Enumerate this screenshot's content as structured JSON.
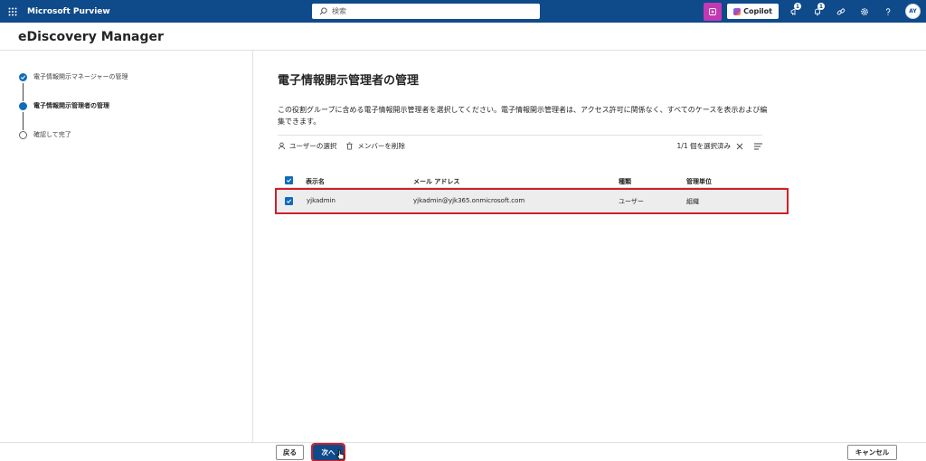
{
  "topbar": {
    "app_name": "Microsoft Purview",
    "search_placeholder": "検索",
    "copilot_label": "Copilot",
    "notification_badge_1": "1",
    "notification_badge_2": "1",
    "avatar_initials": "AY"
  },
  "header": {
    "title": "eDiscovery Manager"
  },
  "steps": [
    {
      "label": "電子情報開示マネージャーの管理",
      "state": "done"
    },
    {
      "label": "電子情報開示管理者の管理",
      "state": "current"
    },
    {
      "label": "確認して完了",
      "state": "todo"
    }
  ],
  "main": {
    "title": "電子情報開示管理者の管理",
    "description": "この役割グループに含める電子情報開示管理者を選択してください。電子情報開示管理者は、アクセス許可に関係なく、すべてのケースを表示および編集できます。",
    "commands": {
      "select_users": "ユーザーの選択",
      "remove_members": "メンバーを削除",
      "selection_status": "1/1 個を選択済み"
    },
    "table": {
      "columns": [
        "表示名",
        "メール アドレス",
        "種類",
        "管理単位"
      ],
      "rows": [
        {
          "display_name": "yjkadmin",
          "email": "yjkadmin@yjk365.onmicrosoft.com",
          "type": "ユーザー",
          "admin_unit": "組織"
        }
      ]
    }
  },
  "footer": {
    "back_label": "戻る",
    "next_label": "次へ",
    "cancel_label": "キャンセル"
  },
  "colors": {
    "topbar": "#0f4a8a",
    "accent": "#0f6cbd",
    "highlight": "#d0202a",
    "copilot_pink": "#c239b3"
  }
}
